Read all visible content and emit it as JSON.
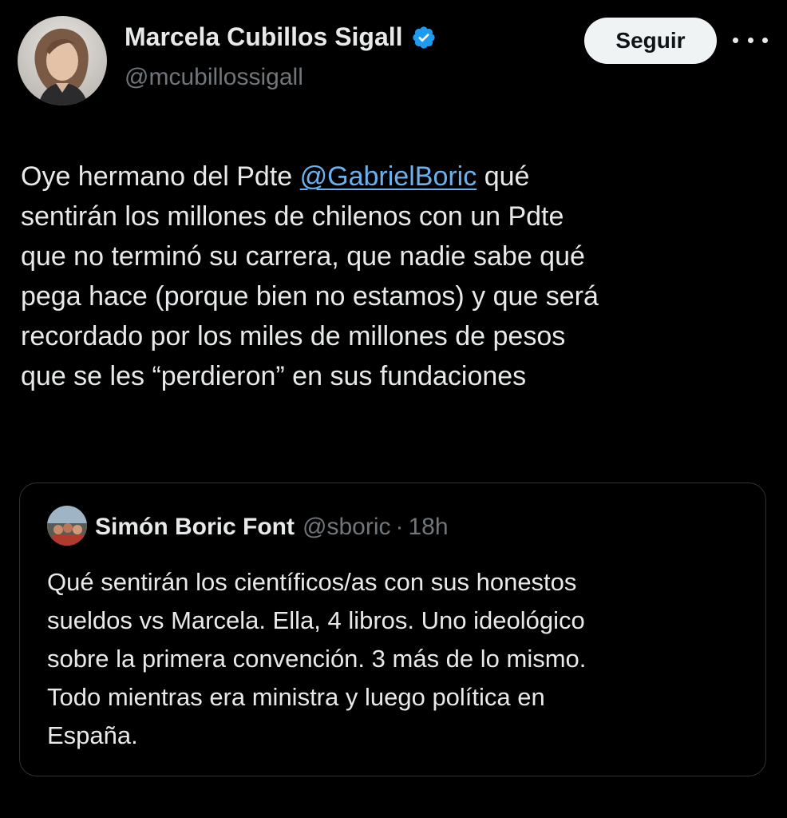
{
  "author": {
    "display_name": "Marcela Cubillos Sigall",
    "handle": "@mcubillossigall",
    "verified_icon": "verified-badge-icon",
    "avatar_icon": "profile-avatar"
  },
  "actions": {
    "follow_label": "Seguir",
    "more_icon": "more-options-icon"
  },
  "tweet": {
    "line1_before": "Oye hermano del Pdte ",
    "mention": "@GabrielBoric",
    "line1_after": " qué",
    "lines": [
      "sentirán los millones de chilenos con un Pdte",
      "que no terminó su carrera, que nadie sabe qué",
      "pega hace (porque bien no estamos) y que será",
      "recordado por los miles de millones de pesos",
      "que se les “perdieron” en sus fundaciones"
    ]
  },
  "quote": {
    "display_name": "Simón Boric Font",
    "handle": "@sboric",
    "separator": "·",
    "time": "18h",
    "lines": [
      "Qué sentirán los científicos/as con sus honestos",
      "sueldos vs Marcela. Ella, 4 libros. Uno ideológico",
      "sobre la primera convención. 3 más de lo mismo.",
      "Todo mientras era ministra y luego política en",
      "España."
    ]
  },
  "colors": {
    "background": "#000000",
    "text": "#e7e9ea",
    "secondary_text": "#71767b",
    "link": "#6ab1ee",
    "verified": "#1d9bf0",
    "button_bg": "#eff3f4",
    "border": "#2f3336"
  }
}
